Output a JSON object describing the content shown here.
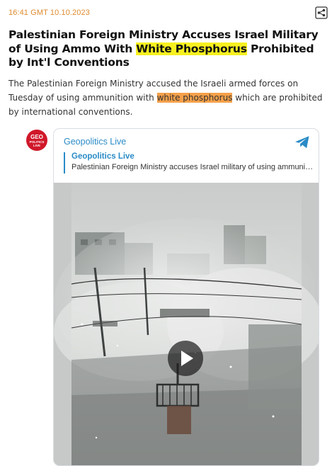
{
  "article": {
    "timestamp": "16:41 GMT 10.10.2023",
    "headline_before": "Palestinian Foreign Ministry Accuses Israel Military of Using Ammo With ",
    "headline_highlight": "White Phosphorus",
    "headline_after": " Prohibited by Int'l Conventions",
    "summary_before": "The Palestinian Foreign Ministry accused the Israeli armed forces on Tuesday of using ammunition with ",
    "summary_highlight": "white phosphorus",
    "summary_after": " which are prohibited by international conventions."
  },
  "embed": {
    "avatar_line1": "GEO",
    "avatar_line2": "POLITICS LIVE",
    "channel_name": "Geopolitics Live",
    "reply_name": "Geopolitics Live",
    "reply_text": "Palestinian Foreign Ministry accuses Israel military of using ammunition with white phosphorus",
    "icons": [
      "share-icon",
      "telegram-icon",
      "play-icon"
    ]
  },
  "colors": {
    "timestamp": "#e08a2c",
    "highlight_yellow": "#f7f01f",
    "highlight_orange": "#f6a04a",
    "telegram_blue": "#2a8bc7",
    "avatar_red": "#d0182a"
  }
}
